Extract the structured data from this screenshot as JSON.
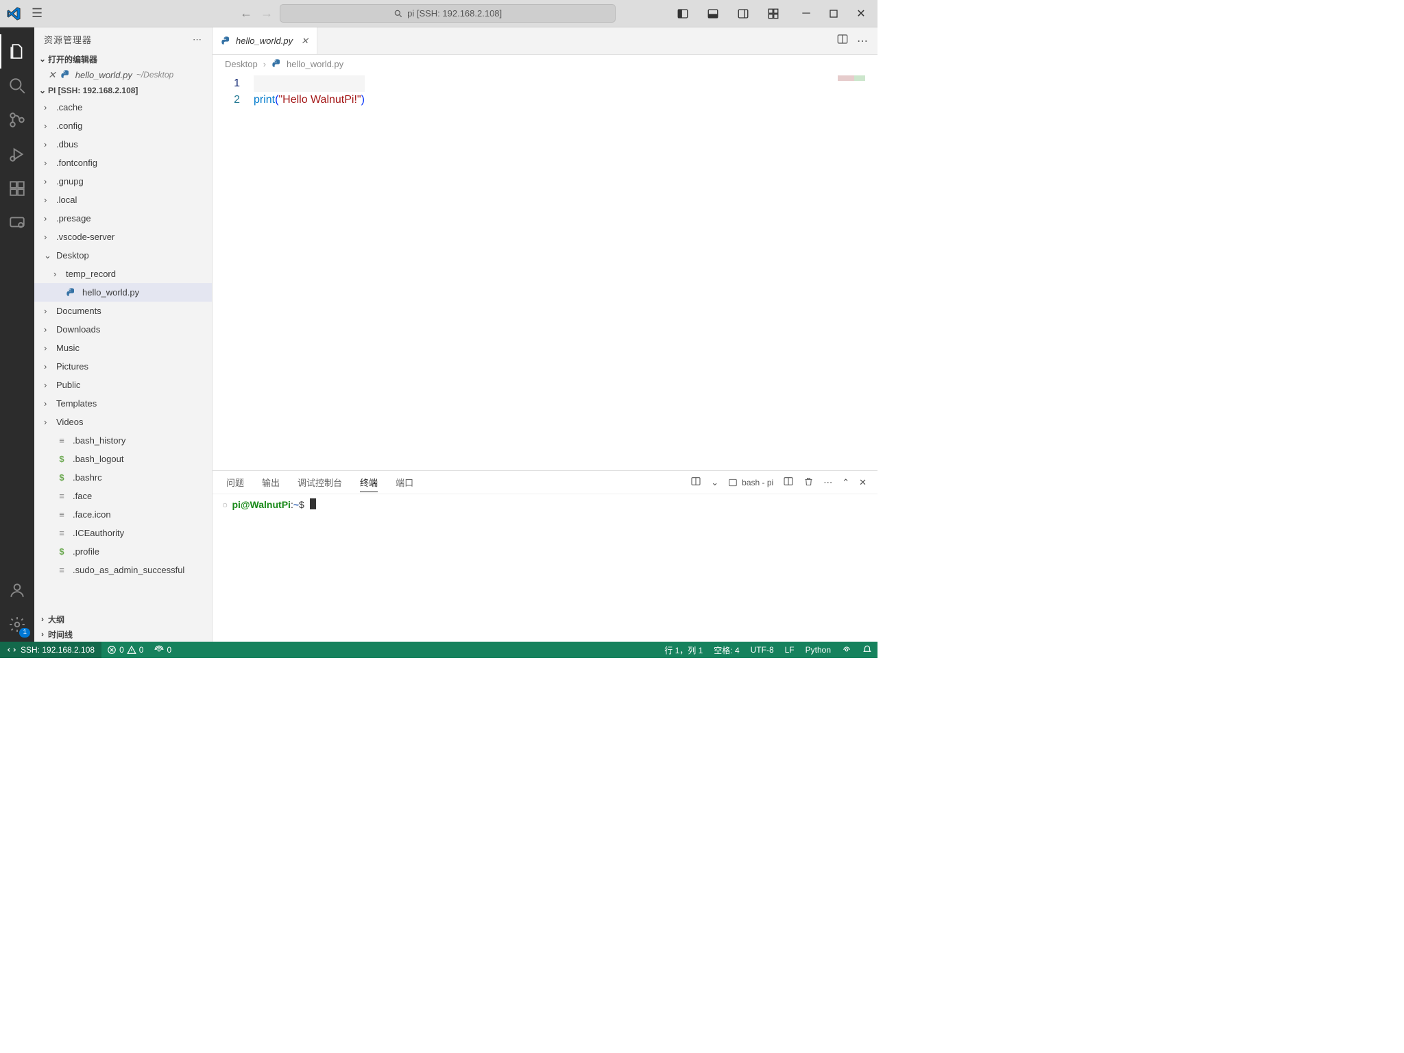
{
  "title": "pi [SSH: 192.168.2.108]",
  "sidebar": {
    "title": "资源管理器",
    "openEditorsLabel": "打开的编辑器",
    "openEditor": {
      "name": "hello_world.py",
      "path": "~/Desktop"
    },
    "rootLabel": "PI [SSH: 192.168.2.108]",
    "items": [
      {
        "name": ".cache",
        "type": "folder"
      },
      {
        "name": ".config",
        "type": "folder"
      },
      {
        "name": ".dbus",
        "type": "folder"
      },
      {
        "name": ".fontconfig",
        "type": "folder"
      },
      {
        "name": ".gnupg",
        "type": "folder"
      },
      {
        "name": ".local",
        "type": "folder"
      },
      {
        "name": ".presage",
        "type": "folder"
      },
      {
        "name": ".vscode-server",
        "type": "folder"
      },
      {
        "name": "Desktop",
        "type": "folder",
        "expanded": true,
        "children": [
          {
            "name": "temp_record",
            "type": "folder"
          },
          {
            "name": "hello_world.py",
            "type": "file",
            "selected": true,
            "icon": "py"
          }
        ]
      },
      {
        "name": "Documents",
        "type": "folder"
      },
      {
        "name": "Downloads",
        "type": "folder"
      },
      {
        "name": "Music",
        "type": "folder"
      },
      {
        "name": "Pictures",
        "type": "folder"
      },
      {
        "name": "Public",
        "type": "folder"
      },
      {
        "name": "Templates",
        "type": "folder"
      },
      {
        "name": "Videos",
        "type": "folder"
      },
      {
        "name": ".bash_history",
        "type": "file",
        "icon": "txt"
      },
      {
        "name": ".bash_logout",
        "type": "file",
        "icon": "sh"
      },
      {
        "name": ".bashrc",
        "type": "file",
        "icon": "sh"
      },
      {
        "name": ".face",
        "type": "file",
        "icon": "txt"
      },
      {
        "name": ".face.icon",
        "type": "file",
        "icon": "txt"
      },
      {
        "name": ".ICEauthority",
        "type": "file",
        "icon": "txt"
      },
      {
        "name": ".profile",
        "type": "file",
        "icon": "sh"
      },
      {
        "name": ".sudo_as_admin_successful",
        "type": "file",
        "icon": "txt"
      }
    ],
    "outlineLabel": "大纲",
    "timelineLabel": "时间线"
  },
  "tab": {
    "name": "hello_world.py"
  },
  "breadcrumb": {
    "root": "Desktop",
    "file": "hello_world.py"
  },
  "code": {
    "lines": [
      "",
      "print(\"Hello WalnutPi!\")"
    ],
    "fn": "print",
    "str": "\"Hello WalnutPi!\""
  },
  "panel": {
    "tabs": [
      "问题",
      "输出",
      "调试控制台",
      "终端",
      "端口"
    ],
    "activeTab": "终端",
    "terminalLabel": "bash - pi",
    "prompt": {
      "user": "pi@WalnutPi",
      "path": "~",
      "sym": "$"
    }
  },
  "status": {
    "remote": "SSH: 192.168.2.108",
    "errors": "0",
    "warnings": "0",
    "ports": "0",
    "lineCol": "行 1，列 1",
    "spaces": "空格: 4",
    "encoding": "UTF-8",
    "eol": "LF",
    "lang": "Python"
  },
  "activitybar": {
    "badge": "1"
  }
}
